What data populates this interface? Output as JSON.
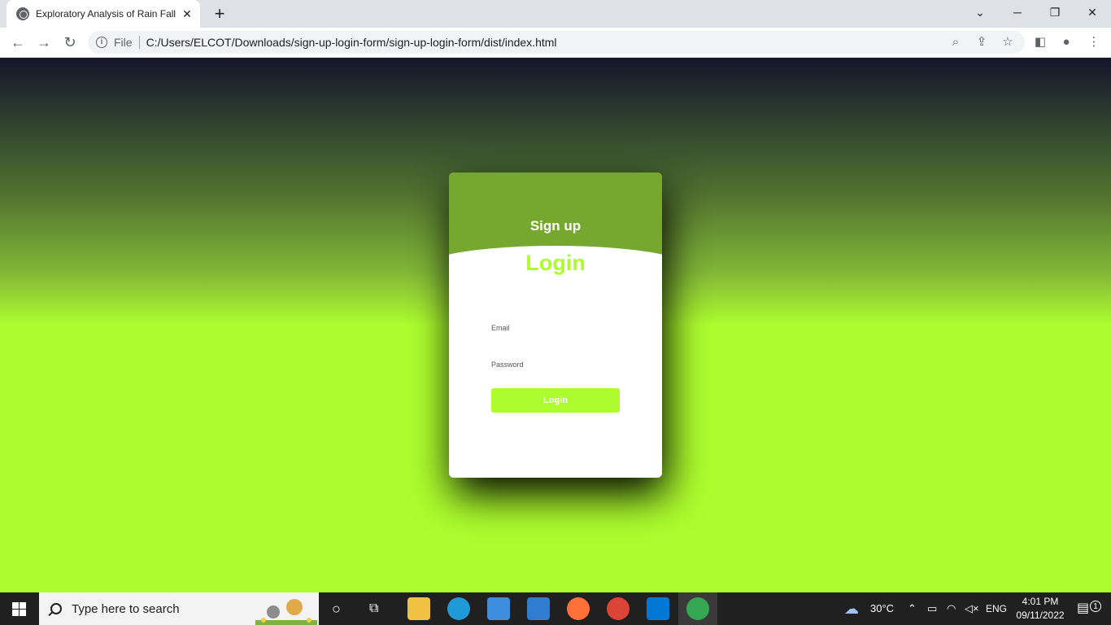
{
  "browser": {
    "tab_title": "Exploratory Analysis of Rain Fall D",
    "scheme_label": "File",
    "url": "C:/Users/ELCOT/Downloads/sign-up-login-form/sign-up-login-form/dist/index.html"
  },
  "card": {
    "signup_title": "Sign up",
    "login_title": "Login",
    "email_label": "Email",
    "password_label": "Password",
    "login_button": "Login"
  },
  "taskbar": {
    "search_placeholder": "Type here to search",
    "weather": "30°C",
    "language": "ENG",
    "time": "4:01 PM",
    "date": "09/11/2022",
    "notification_count": "1"
  },
  "colors": {
    "accent": "#adfd2e",
    "signup_header": "#76a82f",
    "page_top": "#151529"
  }
}
